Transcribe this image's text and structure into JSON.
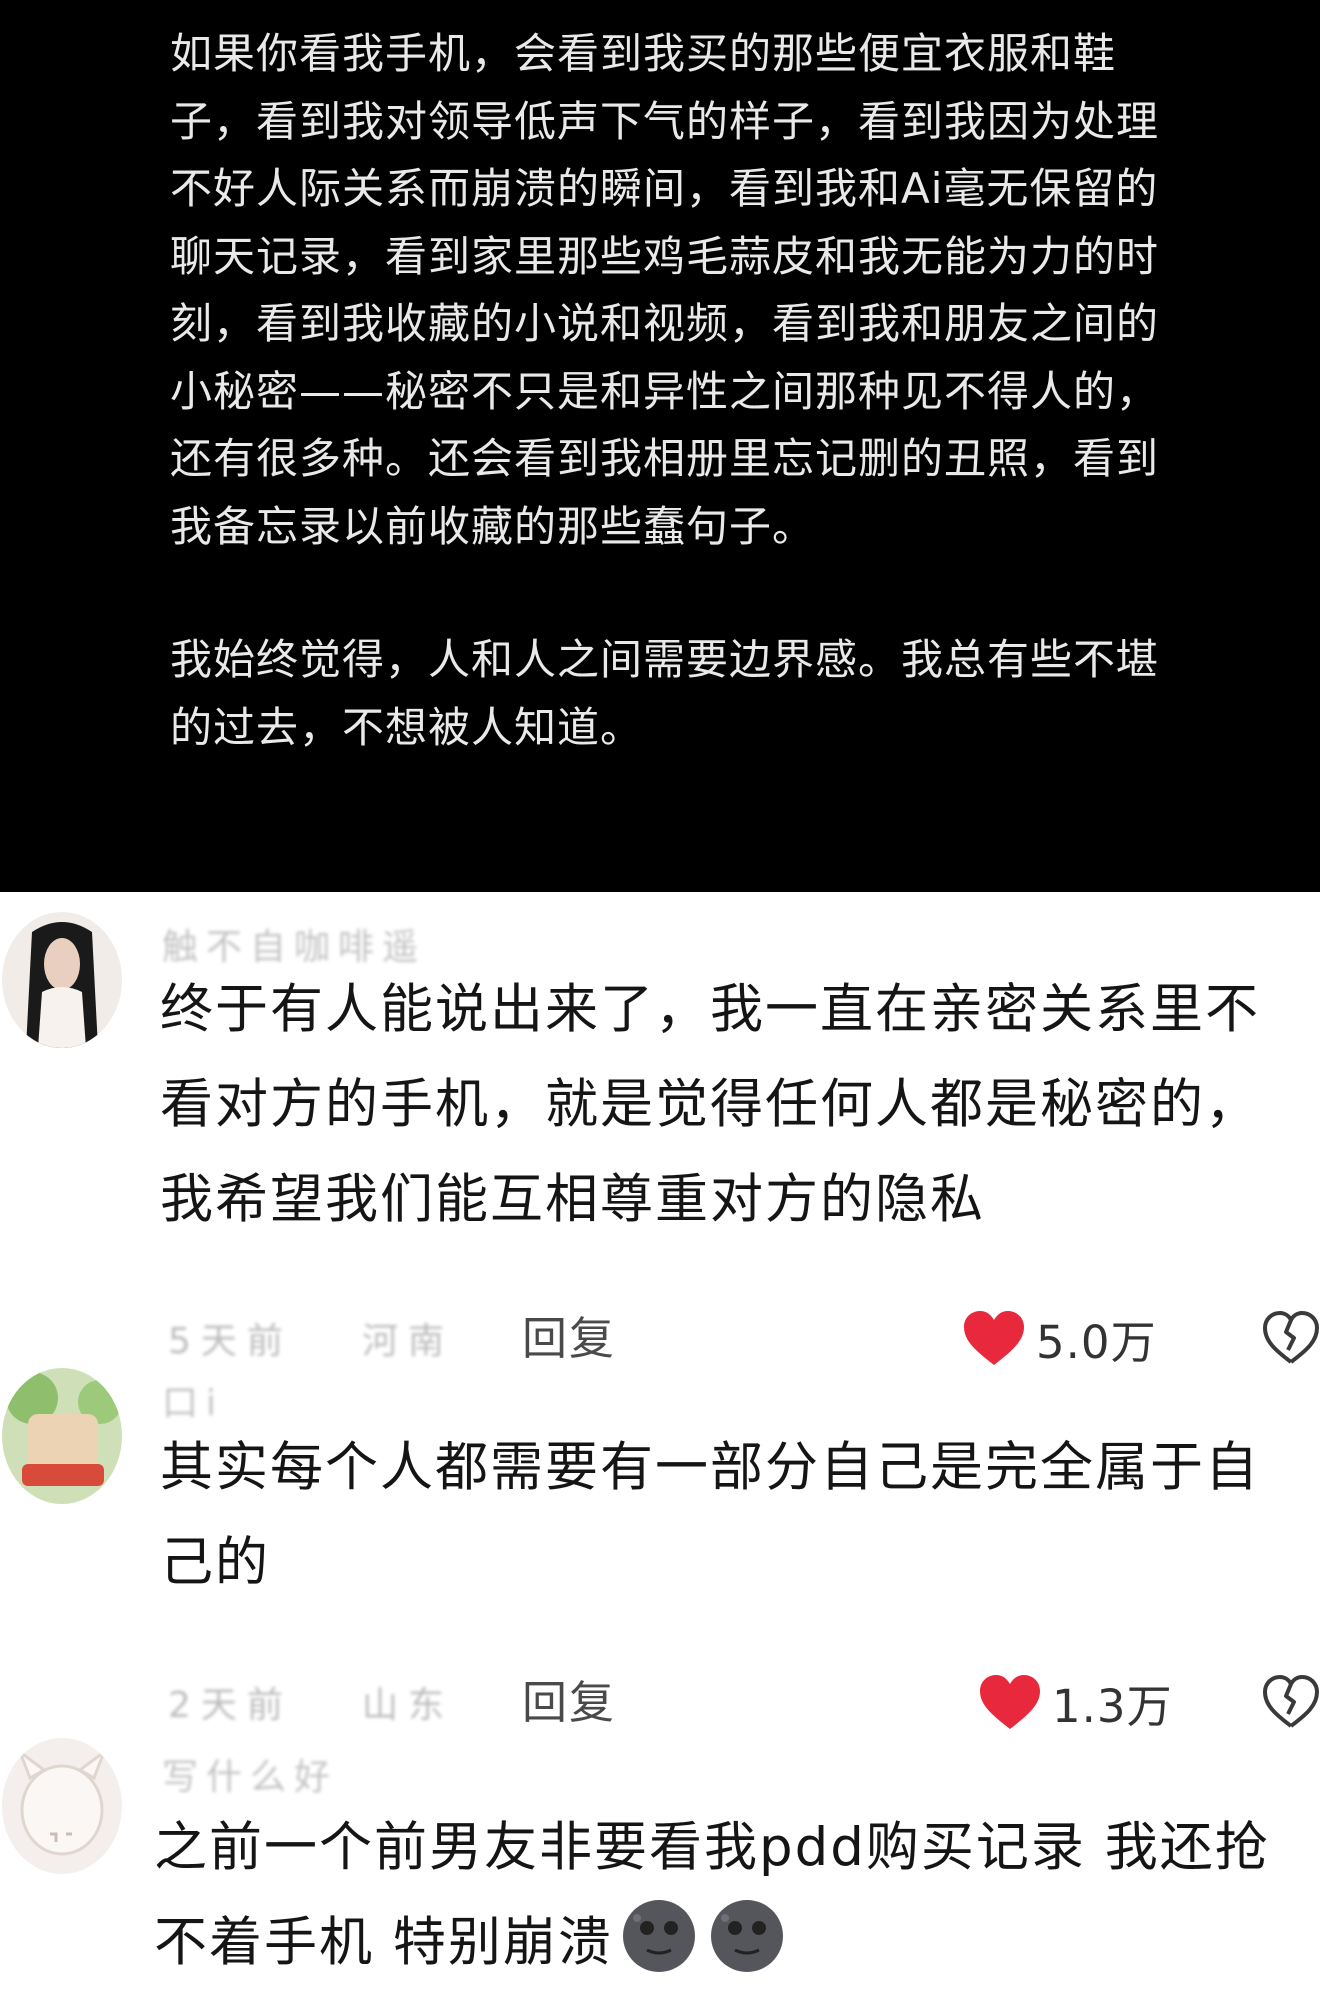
{
  "post": {
    "paragraph_1": "如果你看我手机，会看到我买的那些便宜衣服和鞋子，看到我对领导低声下气的样子，看到我因为处理不好人际关系而崩溃的瞬间，看到我和Ai毫无保留的聊天记录，看到家里那些鸡毛蒜皮和我无能为力的时刻，看到我收藏的小说和视频，看到我和朋友之间的小秘密——秘密不只是和异性之间那种见不得人的，还有很多种。还会看到我相册里忘记删的丑照，看到我备忘录以前收藏的那些蠢句子。",
    "paragraph_2": "我始终觉得，人和人之间需要边界感。我总有些不堪的过去，不想被人知道。"
  },
  "comments": [
    {
      "username": "触不自咖啡遥",
      "text": "终于有人能说出来了，我一直在亲密关系里不看对方的手机，就是觉得任何人都是秘密的，我希望我们能互相尊重对方的隐私",
      "date": "5天前",
      "location": "河南",
      "reply_label": "回复",
      "likes": "5.0万"
    },
    {
      "username": "口i",
      "text": "其实每个人都需要有一部分自己是完全属于自己的",
      "date": "2天前",
      "location": "山东",
      "reply_label": "回复",
      "likes": "1.3万"
    },
    {
      "username": "写什么好",
      "text": "之前一个前男友非要看我pdd购买记录 我还抢不着手机 特别崩溃"
    }
  ],
  "icons": {
    "like": "heart-icon",
    "dislike": "broken-heart-icon",
    "emoji": "new-moon-face-emoji"
  },
  "colors": {
    "post_background": "#000000",
    "post_text": "#e9e9e9",
    "like_red": "#e8283c",
    "comment_text": "#151515"
  }
}
